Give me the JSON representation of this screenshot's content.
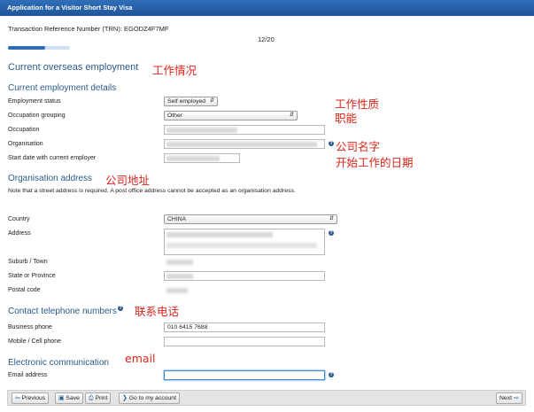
{
  "window": {
    "title": "Application for a Visitor Short Stay Visa"
  },
  "header": {
    "trn": "Transaction Reference Number (TRN): EGODZ4F7MF",
    "page_count": "12/20",
    "progress": 0.6
  },
  "sections": {
    "overseas": {
      "title": "Current overseas employment",
      "annotation": "工作情况"
    },
    "employment_details": {
      "title": "Current employment details"
    },
    "organisation_address": {
      "title": "Organisation address",
      "annotation": "公司地址",
      "note": "Note that a street address is required. A post office address cannot be accepted as an organisation address."
    },
    "contact": {
      "title": "Contact telephone numbers",
      "annotation": "联系电话"
    },
    "electronic": {
      "title": "Electronic communication",
      "annotation": "email"
    }
  },
  "fields": {
    "employment_status": {
      "label": "Employment status",
      "value": "Self employed"
    },
    "occupation_grouping": {
      "label": "Occupation grouping",
      "value": "Other"
    },
    "occupation": {
      "label": "Occupation"
    },
    "organisation": {
      "label": "Organisation"
    },
    "start_date": {
      "label": "Start date with current employer"
    },
    "country": {
      "label": "Country",
      "value": "CHINA"
    },
    "address": {
      "label": "Address"
    },
    "suburb": {
      "label": "Suburb / Town"
    },
    "state": {
      "label": "State or Province"
    },
    "postal": {
      "label": "Postal code"
    },
    "business_phone": {
      "label": "Business phone",
      "value": "010 6415 7688"
    },
    "mobile_phone": {
      "label": "Mobile / Cell phone",
      "value": ""
    },
    "email": {
      "label": "Email address",
      "value": ""
    }
  },
  "annotations": {
    "work_nature": "工作性质",
    "function": "职能",
    "company_name": "公司名字",
    "start_date": "开始工作的日期"
  },
  "footer": {
    "previous": "Previous",
    "save": "Save",
    "print": "Print",
    "go_to_account": "Go to my account",
    "next": "Next"
  },
  "colors": {
    "titlebar": "#1f5599",
    "heading": "#2a5a8a",
    "annotation": "#d9231b"
  }
}
